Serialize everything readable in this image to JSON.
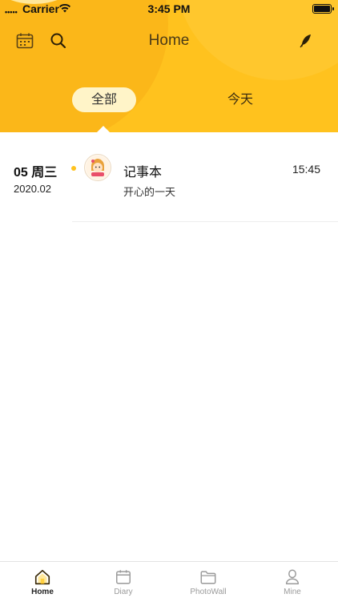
{
  "status_bar": {
    "carrier": "Carrier",
    "time": "3:45 PM",
    "signal_glyph": "•••••"
  },
  "header": {
    "title": "Home",
    "tabs": [
      {
        "label": "全部",
        "selected": true
      },
      {
        "label": "今天",
        "selected": false
      }
    ],
    "icons": [
      "calendar-icon",
      "search-icon",
      "feather-icon"
    ]
  },
  "entries": [
    {
      "day": "05 周三",
      "year_month": "2020.02",
      "title": "记事本",
      "time": "15:45",
      "subtitle": "开心的一天"
    }
  ],
  "tabbar": {
    "items": [
      {
        "label": "Home",
        "icon": "home-icon",
        "active": true
      },
      {
        "label": "Diary",
        "icon": "diary-icon",
        "active": false
      },
      {
        "label": "PhotoWall",
        "icon": "folder-icon",
        "active": false
      },
      {
        "label": "Mine",
        "icon": "person-icon",
        "active": false
      }
    ]
  },
  "colors": {
    "accent": "#ffc21e",
    "tab_pill": "#fff4c8",
    "header_dark": "#fbb719"
  }
}
